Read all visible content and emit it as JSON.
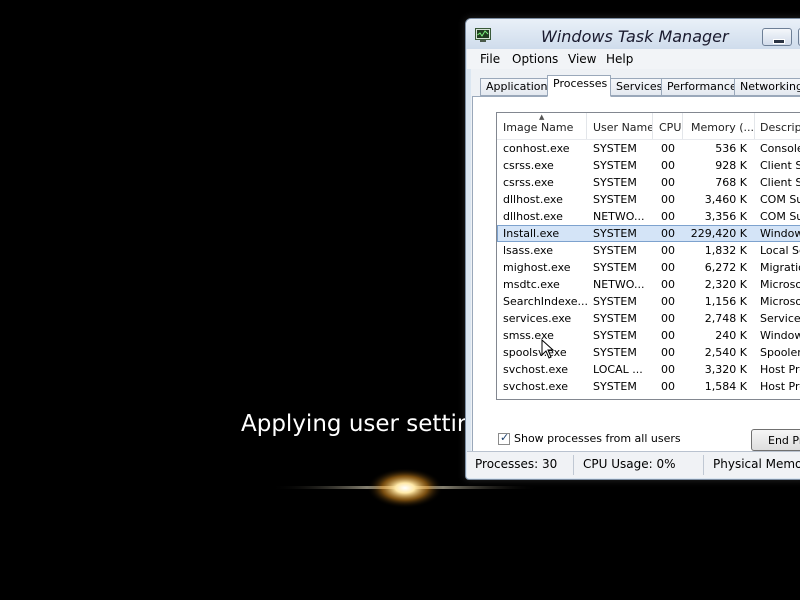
{
  "background": {
    "status_text": "Applying user setting"
  },
  "window": {
    "title": "Windows Task Manager",
    "icon": "task-manager-icon"
  },
  "menu": [
    "File",
    "Options",
    "View",
    "Help"
  ],
  "tabs": [
    "Applications",
    "Processes",
    "Services",
    "Performance",
    "Networking"
  ],
  "active_tab": "Processes",
  "columns": [
    "Image Name",
    "User Name",
    "CPU",
    "Memory (...",
    "Descripti"
  ],
  "processes": [
    {
      "name": "conhost.exe",
      "user": "SYSTEM",
      "cpu": "00",
      "memory": "536 K",
      "description": "Console"
    },
    {
      "name": "csrss.exe",
      "user": "SYSTEM",
      "cpu": "00",
      "memory": "928 K",
      "description": "Client Se"
    },
    {
      "name": "csrss.exe",
      "user": "SYSTEM",
      "cpu": "00",
      "memory": "768 K",
      "description": "Client Se"
    },
    {
      "name": "dllhost.exe",
      "user": "SYSTEM",
      "cpu": "00",
      "memory": "3,460 K",
      "description": "COM Sur"
    },
    {
      "name": "dllhost.exe",
      "user": "NETWO...",
      "cpu": "00",
      "memory": "3,356 K",
      "description": "COM Sur"
    },
    {
      "name": "Install.exe",
      "user": "SYSTEM",
      "cpu": "00",
      "memory": "229,420 K",
      "description": "Windows"
    },
    {
      "name": "lsass.exe",
      "user": "SYSTEM",
      "cpu": "00",
      "memory": "1,832 K",
      "description": "Local Se"
    },
    {
      "name": "mighost.exe",
      "user": "SYSTEM",
      "cpu": "00",
      "memory": "6,272 K",
      "description": "Migration"
    },
    {
      "name": "msdtc.exe",
      "user": "NETWO...",
      "cpu": "00",
      "memory": "2,320 K",
      "description": "Microsof"
    },
    {
      "name": "SearchIndexe...",
      "user": "SYSTEM",
      "cpu": "00",
      "memory": "1,156 K",
      "description": "Microsof"
    },
    {
      "name": "services.exe",
      "user": "SYSTEM",
      "cpu": "00",
      "memory": "2,748 K",
      "description": "Services"
    },
    {
      "name": "smss.exe",
      "user": "SYSTEM",
      "cpu": "00",
      "memory": "240 K",
      "description": "Windows"
    },
    {
      "name": "spoolsv.exe",
      "user": "SYSTEM",
      "cpu": "00",
      "memory": "2,540 K",
      "description": "Spooler S"
    },
    {
      "name": "svchost.exe",
      "user": "LOCAL ...",
      "cpu": "00",
      "memory": "3,320 K",
      "description": "Host Pro"
    },
    {
      "name": "svchost.exe",
      "user": "SYSTEM",
      "cpu": "00",
      "memory": "1,584 K",
      "description": "Host Pro"
    }
  ],
  "selected_process": "Install.exe",
  "show_all_label": "Show processes from all users",
  "show_all_checked": true,
  "end_process_label": "End Pro",
  "status": {
    "processes": "Processes: 30",
    "cpu": "CPU Usage: 0%",
    "memory": "Physical Memory"
  },
  "colors": {
    "background": "#000000",
    "selection": "#d4e4f7",
    "window_frame": "#dbe6f1"
  }
}
